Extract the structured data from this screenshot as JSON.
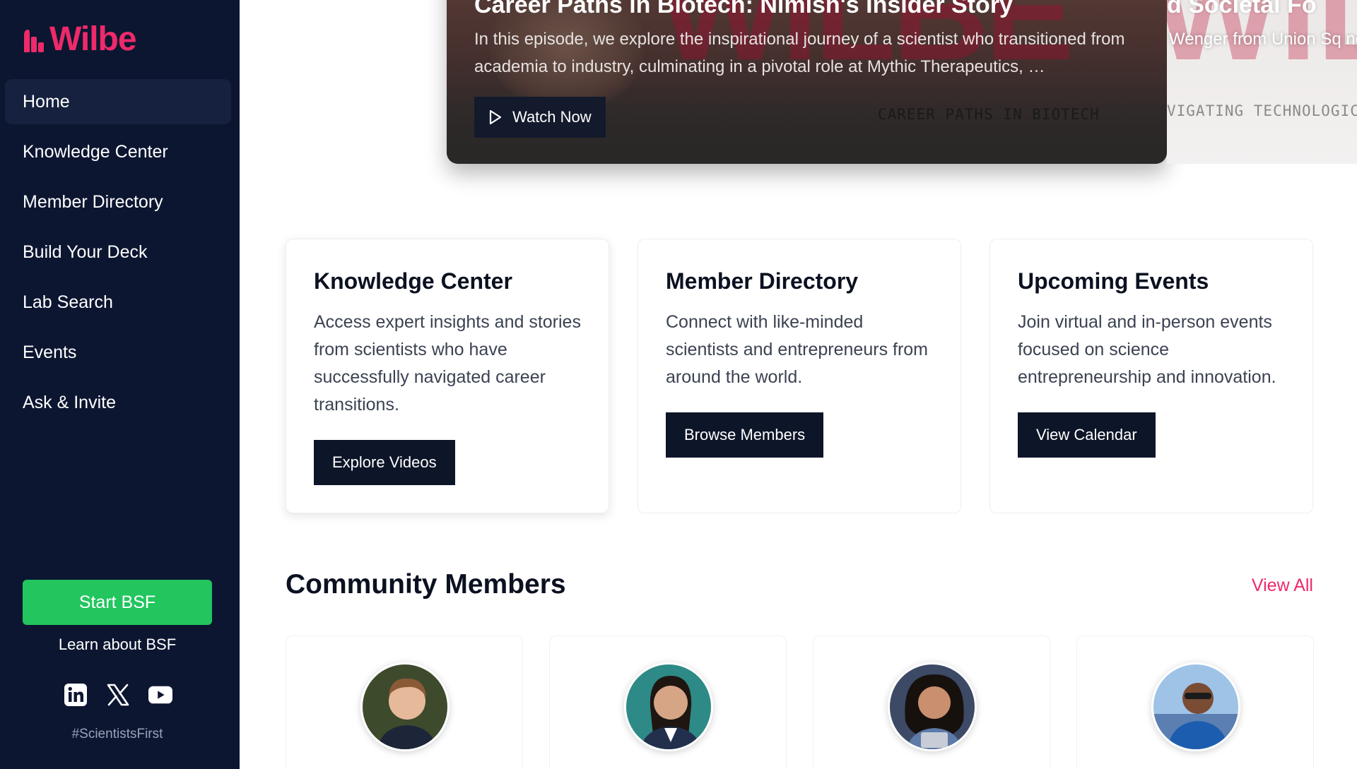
{
  "brand": {
    "name": "Wilbe",
    "color": "#ee2a6a"
  },
  "sidebar": {
    "items": [
      {
        "label": "Home",
        "active": true
      },
      {
        "label": "Knowledge Center"
      },
      {
        "label": "Member Directory"
      },
      {
        "label": "Build Your Deck"
      },
      {
        "label": "Lab Search"
      },
      {
        "label": "Events"
      },
      {
        "label": "Ask & Invite"
      }
    ],
    "cta_label": "Start BSF",
    "learn_label": "Learn about BSF",
    "socials": [
      "linkedin-icon",
      "x-icon",
      "youtube-icon"
    ],
    "hashtag": "#ScientistsFirst"
  },
  "hero": {
    "title": "Career Paths in Biotech: Nimish's Insider Story",
    "description": "In this episode, we explore the inspirational journey of a scientist who transitioned from academia to industry, culminating in a pivotal role at Mythic Therapeutics, …",
    "watch_label": "Watch Now",
    "caption": "CAREER PATHS IN BIOTECH",
    "bigword": "WILBE"
  },
  "hero_next": {
    "title": "d Societal Fo",
    "description": "Wenger from Union Sq ng to understand the int",
    "caption": "VIGATING TECHNOLOGIC"
  },
  "cards": [
    {
      "title": "Knowledge Center",
      "text": "Access expert insights and stories from scientists who have successfully navigated career transitions.",
      "button": "Explore Videos"
    },
    {
      "title": "Member Directory",
      "text": "Connect with like-minded scientists and entrepreneurs from around the world.",
      "button": "Browse Members"
    },
    {
      "title": "Upcoming Events",
      "text": "Join virtual and in-person events focused on science entrepreneurship and innovation.",
      "button": "View Calendar"
    }
  ],
  "community": {
    "title": "Community Members",
    "view_all": "View All"
  }
}
